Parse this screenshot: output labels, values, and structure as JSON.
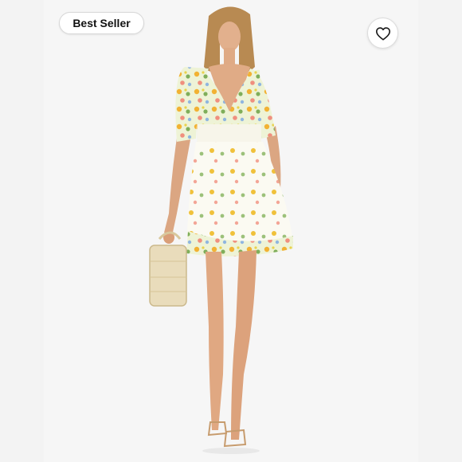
{
  "listing": {
    "badge_label": "Best Seller",
    "like_icon": "heart-icon",
    "image_icon": "product-photo",
    "colors": {
      "background": "#ffffff",
      "side_panel": "#f3f3f3",
      "photo_panel": "#f6f6f6",
      "badge_text": "#111111"
    }
  }
}
